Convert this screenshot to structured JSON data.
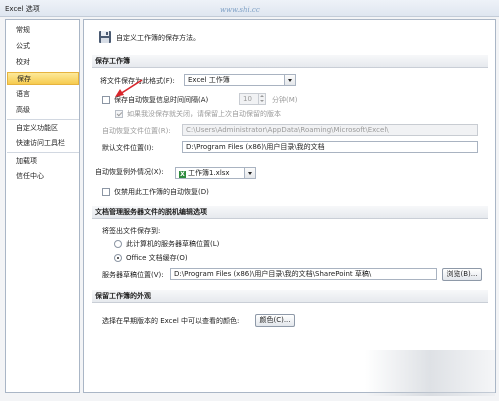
{
  "window": {
    "title": "Excel 选项",
    "watermark": "www.shi.cc"
  },
  "sidebar": {
    "items": [
      {
        "label": "常规"
      },
      {
        "label": "公式"
      },
      {
        "label": "校对"
      },
      {
        "label": "保存"
      },
      {
        "label": "语言"
      },
      {
        "label": "高级"
      },
      {
        "label": "自定义功能区"
      },
      {
        "label": "快速访问工具栏"
      },
      {
        "label": "加载项"
      },
      {
        "label": "信任中心"
      }
    ],
    "active": "保存"
  },
  "header": {
    "text": "自定义工作簿的保存方法。"
  },
  "save_workbooks": {
    "title": "保存工作簿",
    "format_label": "将文件保存为此格式(F):",
    "format_value": "Excel 工作簿",
    "autorecover_label": "保存自动恢复信息时间间隔(A)",
    "autorecover_minutes": "10",
    "minutes_label": "分钟(M)",
    "keep_last_label": "如果我没保存就关闭，请保留上次自动保留的版本",
    "autorecover_path_label": "自动恢复文件位置(R):",
    "autorecover_path": "C:\\Users\\Administrator\\AppData\\Roaming\\Microsoft\\Excel\\",
    "default_path_label": "默认文件位置(I):",
    "default_path": "D:\\Program Files (x86)\\用户目录\\我的文档"
  },
  "autorecover_exceptions": {
    "label": "自动恢复例外情况(X):",
    "workbook": "工作簿1.xlsx",
    "disable_label": "仅禁用此工作簿的自动恢复(D)"
  },
  "offline_editing": {
    "title": "文档管理服务器文件的脱机编辑选项",
    "save_to_label": "将签出文件保存到:",
    "option_server": "此计算机的服务器草稿位置(L)",
    "option_cache": "Office 文档缓存(O)",
    "drafts_label": "服务器草稿位置(V):",
    "drafts_path": "D:\\Program Files (x86)\\用户目录\\我的文档\\SharePoint 草稿\\",
    "browse_label": "浏览(B)..."
  },
  "appearance": {
    "title": "保留工作簿的外观",
    "colors_label": "选择在早期版本的 Excel 中可以查看的颜色:",
    "colors_button": "颜色(C)..."
  },
  "colors": {
    "accent_active": "#f6cb4f",
    "arrow": "#d9262c"
  }
}
